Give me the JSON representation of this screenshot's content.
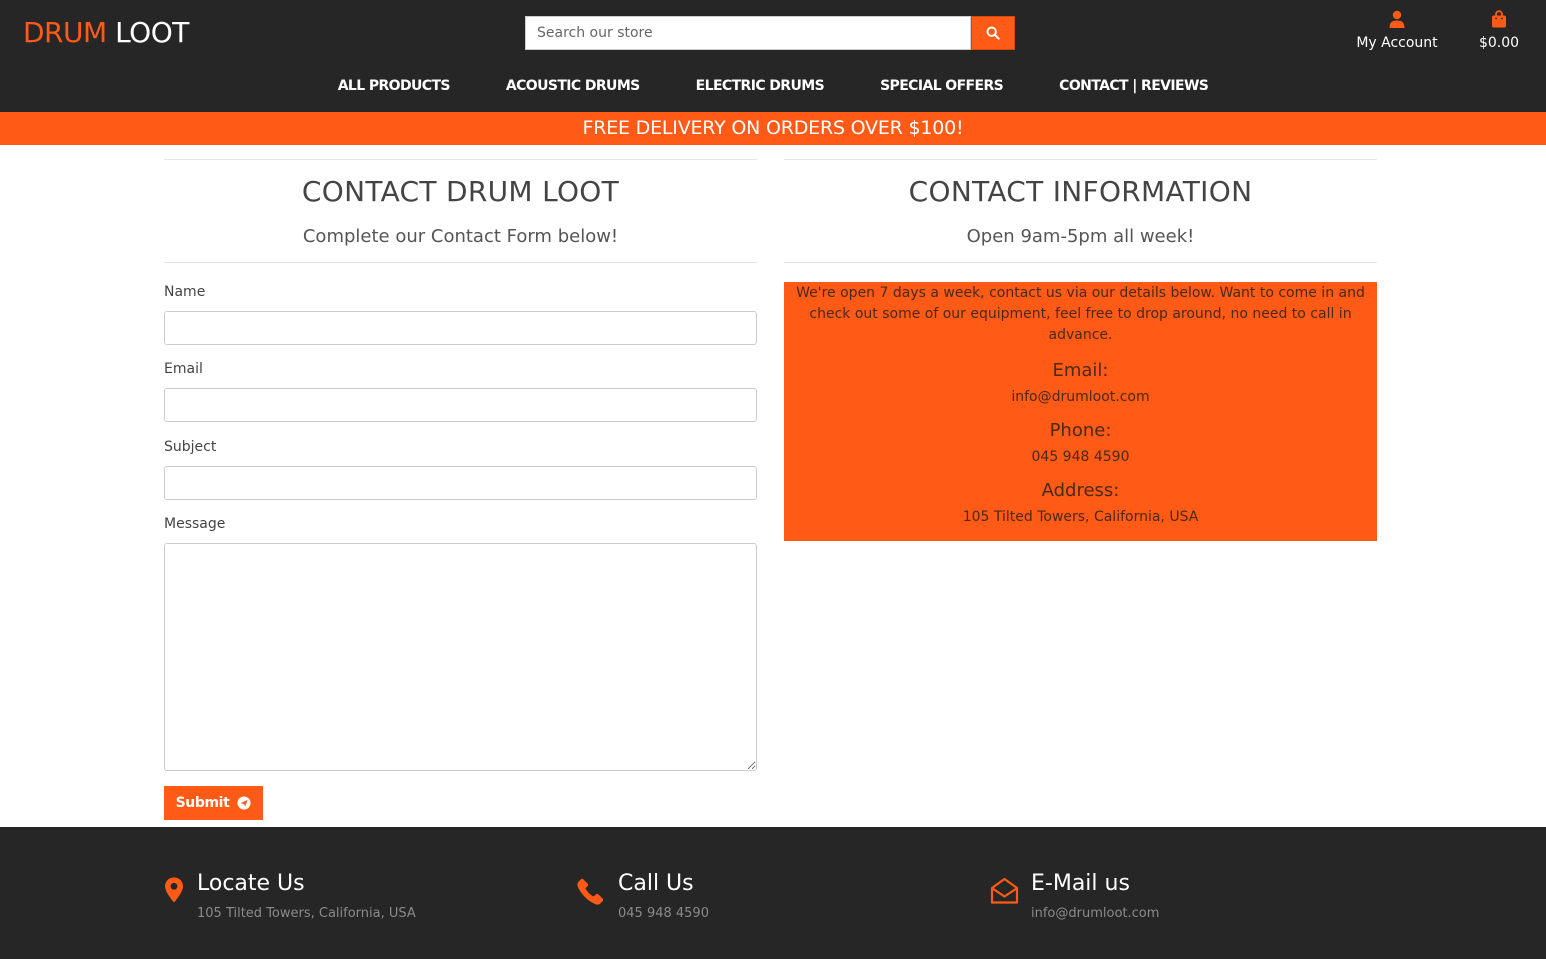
{
  "header": {
    "logo_part1": "DRUM",
    "logo_part2": "LOOT",
    "search_placeholder": "Search our store",
    "account_label": "My Account",
    "cart_total": "$0.00"
  },
  "nav": {
    "items": [
      "ALL PRODUCTS",
      "ACOUSTIC DRUMS",
      "ELECTRIC DRUMS",
      "SPECIAL OFFERS",
      "CONTACT | REVIEWS"
    ]
  },
  "banner": {
    "text": "FREE DELIVERY ON ORDERS OVER $100!"
  },
  "contact_form": {
    "title": "CONTACT DRUM LOOT",
    "subtitle": "Complete our Contact Form below!",
    "name_label": "Name",
    "email_label": "Email",
    "subject_label": "Subject",
    "message_label": "Message",
    "submit_label": "Submit"
  },
  "contact_info": {
    "title": "CONTACT INFORMATION",
    "subtitle": "Open 9am-5pm all week!",
    "intro": "We're open 7 days a week, contact us via our details below. Want to come in and check out some of our equipment, feel free to drop around, no need to call in advance.",
    "email_heading": "Email:",
    "email_value": "info@drumloot.com",
    "phone_heading": "Phone:",
    "phone_value": "045 948 4590",
    "address_heading": "Address:",
    "address_value": "105 Tilted Towers, California, USA"
  },
  "footer": {
    "locate_title": "Locate Us",
    "locate_text": "105 Tilted Towers, California, USA",
    "call_title": "Call Us",
    "call_text": "045 948 4590",
    "email_title": "E-Mail us",
    "email_text": "info@drumloot.com"
  },
  "colors": {
    "accent": "#ff5a16",
    "header_bg": "#262626"
  },
  "icons": [
    "search-icon",
    "user-icon",
    "shopping-bag-icon",
    "paper-plane-icon",
    "map-marker-icon",
    "phone-icon",
    "envelope-open-icon"
  ]
}
